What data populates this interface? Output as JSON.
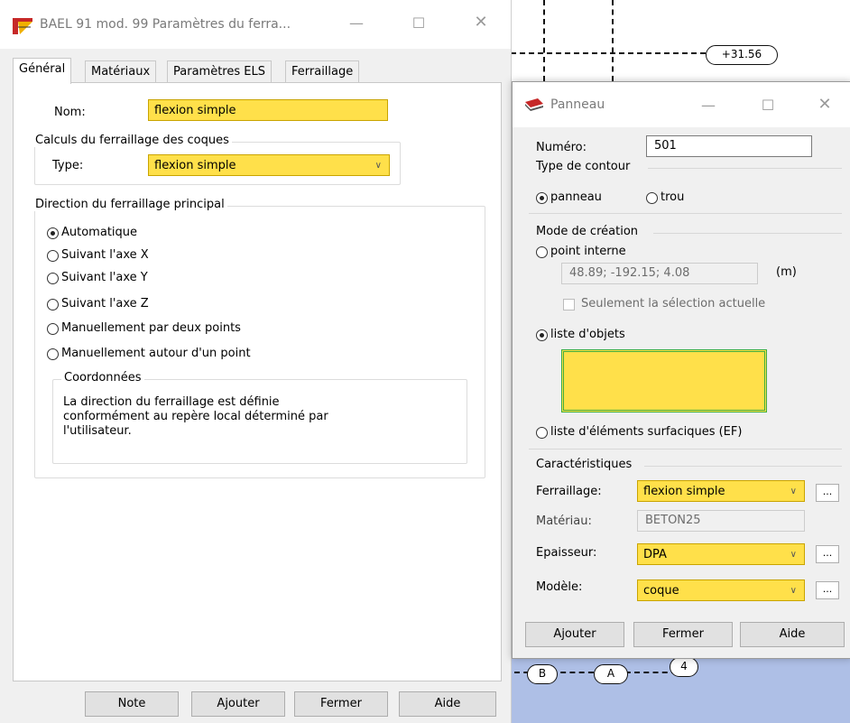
{
  "colors": {
    "highlight": "#ffe04a",
    "cad_bg": "#aebfe6"
  },
  "cad": {
    "level_label": "+31.56",
    "axis_labels": [
      "B",
      "A",
      "4"
    ]
  },
  "main_dialog": {
    "title": "BAEL 91 mod. 99 Paramètres du ferra...",
    "window_buttons": {
      "minimize": "—",
      "maximize": "☐",
      "close": "✕"
    },
    "tabs": [
      "Général",
      "Matériaux",
      "Paramètres ELS",
      "Ferraillage"
    ],
    "name_label": "Nom:",
    "name_value": "flexion simple",
    "calc_group": {
      "legend": "Calculs du ferraillage des coques",
      "type_label": "Type:",
      "type_value": "flexion simple"
    },
    "direction_group": {
      "legend": "Direction du ferraillage principal",
      "options": [
        "Automatique",
        "Suivant l'axe X",
        "Suivant l'axe Y",
        "Suivant l'axe Z",
        "Manuellement par deux points",
        "Manuellement autour d'un point"
      ],
      "selected": "Automatique"
    },
    "coords_group": {
      "legend": "Coordonnées",
      "text_line1": "La direction du ferraillage est définie",
      "text_line2": "conformément au repère local déterminé par",
      "text_line3": "l'utilisateur."
    },
    "buttons": {
      "note": "Note",
      "ajouter": "Ajouter",
      "fermer": "Fermer",
      "aide": "Aide"
    }
  },
  "panneau_dialog": {
    "title": "Panneau",
    "window_buttons": {
      "minimize": "—",
      "maximize": "☐",
      "close": "✕"
    },
    "numero_label": "Numéro:",
    "numero_value": "501",
    "contour": {
      "legend": "Type de contour",
      "panneau": "panneau",
      "trou": "trou",
      "selected": "panneau"
    },
    "mode": {
      "legend": "Mode de création",
      "point_interne": "point interne",
      "coords_value": "48.89; -192.15; 4.08",
      "unit": "(m)",
      "seulement": "Seulement la sélection actuelle",
      "liste_objets": "liste d'objets",
      "liste_elements": "liste d'éléments surfaciques (EF)",
      "selected": "liste d'objets"
    },
    "caract": {
      "legend": "Caractéristiques",
      "ferraillage_label": "Ferraillage:",
      "ferraillage_value": "flexion simple",
      "materiau_label": "Matériau:",
      "materiau_value": "BETON25",
      "epaisseur_label": "Epaisseur:",
      "epaisseur_value": "DPA",
      "modele_label": "Modèle:",
      "modele_value": "coque",
      "more_button": "..."
    },
    "buttons": {
      "ajouter": "Ajouter",
      "fermer": "Fermer",
      "aide": "Aide"
    }
  }
}
